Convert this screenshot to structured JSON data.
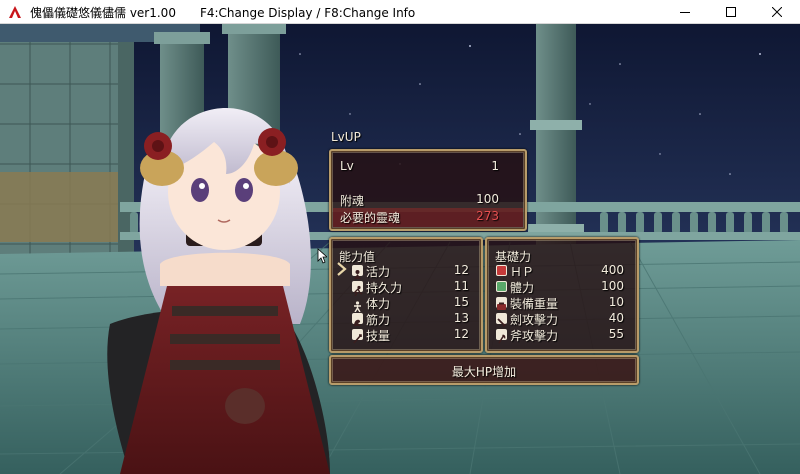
{
  "window": {
    "title": "傀儡儀礎悠儀儘儒 ver1.00",
    "hint": "F4:Change Display / F8:Change Info"
  },
  "menu": {
    "title": "LvUP",
    "level": {
      "label": "Lv",
      "value": "1"
    },
    "soul": {
      "label": "附魂",
      "value": "100"
    },
    "required_soul": {
      "label": "必要的靈魂",
      "value": "273",
      "color": "#e55050"
    },
    "ability": {
      "header": "能力值",
      "rows": [
        {
          "label": "活力",
          "value": "12",
          "icon": "vitality-icon"
        },
        {
          "label": "持久力",
          "value": "11",
          "icon": "endurance-icon"
        },
        {
          "label": "体力",
          "value": "15",
          "icon": "stamina-icon"
        },
        {
          "label": "筋力",
          "value": "13",
          "icon": "strength-icon"
        },
        {
          "label": "技量",
          "value": "12",
          "icon": "dexterity-icon"
        }
      ]
    },
    "base": {
      "header": "基礎力",
      "rows": [
        {
          "label": "ＨＰ",
          "value": "400",
          "icon": "hp-icon"
        },
        {
          "label": "體力",
          "value": "100",
          "icon": "stamina-gauge-icon"
        },
        {
          "label": "裝備重量",
          "value": "10",
          "icon": "equip-weight-icon"
        },
        {
          "label": "劍攻擊力",
          "value": "40",
          "icon": "sword-attack-icon"
        },
        {
          "label": "斧攻擊力",
          "value": "55",
          "icon": "axe-attack-icon"
        }
      ]
    },
    "description": "最大HP增加"
  },
  "colors": {
    "frame_border": "#b89c6a",
    "panel_bg": "#261012",
    "highlight": "#8c2828",
    "text": "#f3ecdd"
  }
}
